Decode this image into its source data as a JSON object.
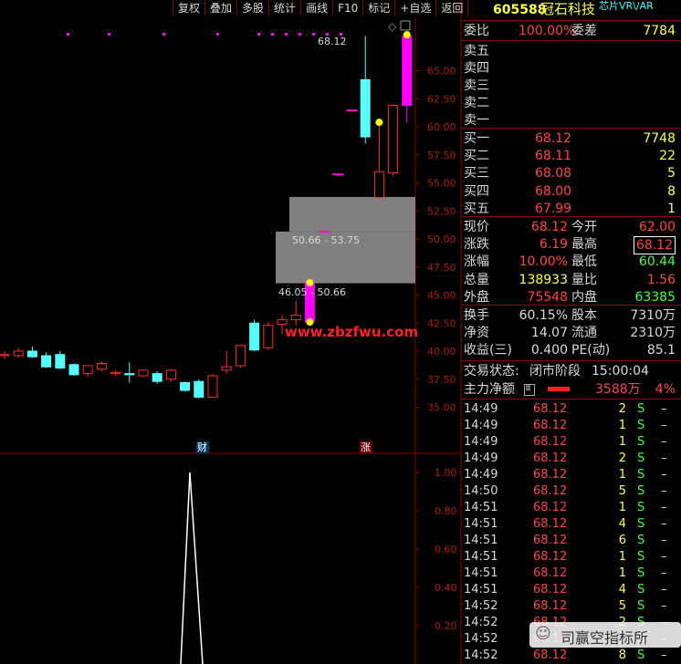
{
  "toolbar": [
    "复权",
    "叠加",
    "多股",
    "统计",
    "画线",
    "F10",
    "标记",
    "+自选",
    "返回"
  ],
  "watermark": "www.zbzfwu.com",
  "chart": {
    "max_label": "68.12",
    "zone_upper_label": "50.66 - 53.75",
    "zone_lower_label": "46.05 - 50.66",
    "price_axis": [
      "65.00",
      "62.50",
      "60.00",
      "57.50",
      "55.00",
      "52.50",
      "50.00",
      "47.50",
      "45.00",
      "42.50",
      "40.00",
      "37.50",
      "35.00"
    ],
    "markers": [
      "财",
      "涨"
    ],
    "indicator_axis": [
      "1.00",
      "0.80",
      "0.60",
      "0.40",
      "0.20"
    ],
    "candles": [
      {
        "o": 39.6,
        "h": 40.0,
        "l": 39.3,
        "c": 39.7
      },
      {
        "o": 39.6,
        "h": 40.3,
        "l": 39.4,
        "c": 40.0
      },
      {
        "o": 40.0,
        "h": 40.4,
        "l": 39.4,
        "c": 39.5
      },
      {
        "o": 39.6,
        "h": 39.9,
        "l": 38.5,
        "c": 38.6
      },
      {
        "o": 39.7,
        "h": 40.0,
        "l": 38.4,
        "c": 38.5
      },
      {
        "o": 38.8,
        "h": 38.9,
        "l": 37.8,
        "c": 37.9
      },
      {
        "o": 38.0,
        "h": 38.8,
        "l": 37.7,
        "c": 38.7
      },
      {
        "o": 38.4,
        "h": 39.1,
        "l": 38.2,
        "c": 38.9
      },
      {
        "o": 38.0,
        "h": 38.3,
        "l": 37.8,
        "c": 38.1
      },
      {
        "o": 38.0,
        "h": 39.0,
        "l": 37.2,
        "c": 37.9
      },
      {
        "o": 37.8,
        "h": 38.4,
        "l": 37.7,
        "c": 38.3
      },
      {
        "o": 38.0,
        "h": 38.2,
        "l": 37.1,
        "c": 37.3
      },
      {
        "o": 37.5,
        "h": 38.4,
        "l": 37.3,
        "c": 38.3
      },
      {
        "o": 37.2,
        "h": 37.3,
        "l": 36.4,
        "c": 36.5
      },
      {
        "o": 37.3,
        "h": 37.5,
        "l": 35.8,
        "c": 35.9
      },
      {
        "o": 35.9,
        "h": 38.0,
        "l": 35.9,
        "c": 37.8
      },
      {
        "o": 38.3,
        "h": 40.0,
        "l": 38.0,
        "c": 38.6
      },
      {
        "o": 38.7,
        "h": 40.6,
        "l": 38.5,
        "c": 40.5
      },
      {
        "o": 42.5,
        "h": 42.8,
        "l": 40.0,
        "c": 40.1
      },
      {
        "o": 40.3,
        "h": 42.6,
        "l": 40.1,
        "c": 42.3
      },
      {
        "o": 42.4,
        "h": 43.2,
        "l": 41.5,
        "c": 42.8
      },
      {
        "o": 42.8,
        "h": 44.5,
        "l": 42.3,
        "c": 43.2
      },
      {
        "o": 42.6,
        "h": 46.1,
        "l": 42.6,
        "c": 46.1
      },
      {
        "o": 50.7,
        "h": 50.7,
        "l": 50.7,
        "c": 50.7
      },
      {
        "o": 55.8,
        "h": 55.8,
        "l": 55.8,
        "c": 55.8
      },
      {
        "o": 61.5,
        "h": 61.5,
        "l": 61.5,
        "c": 61.5
      },
      {
        "o": 64.2,
        "h": 68.1,
        "l": 58.5,
        "c": 59.1
      },
      {
        "o": 53.7,
        "h": 60.4,
        "l": 53.6,
        "c": 56.0
      },
      {
        "o": 55.9,
        "h": 62.0,
        "l": 55.6,
        "c": 61.9
      },
      {
        "o": 61.9,
        "h": 68.2,
        "l": 60.4,
        "c": 68.1
      }
    ]
  },
  "quote": {
    "code": "605588",
    "name": "冠石科技",
    "tag": "芯片VR\\/AR",
    "weibi_label": "委比",
    "weibi_value": "100.00%",
    "weicha_label": "委差",
    "weicha_value": "7784",
    "sells": [
      "卖五",
      "卖四",
      "卖三",
      "卖二",
      "卖一"
    ],
    "buys": [
      {
        "label": "买一",
        "price": "68.12",
        "vol": "7748"
      },
      {
        "label": "买二",
        "price": "68.11",
        "vol": "22"
      },
      {
        "label": "买三",
        "price": "68.08",
        "vol": "5"
      },
      {
        "label": "买四",
        "price": "68.00",
        "vol": "8"
      },
      {
        "label": "买五",
        "price": "67.99",
        "vol": "1"
      }
    ],
    "stats": [
      {
        "l1": "现价",
        "v1": "68.12",
        "l2": "今开",
        "v2": "62.00"
      },
      {
        "l1": "涨跌",
        "v1": "6.19",
        "l2": "最高",
        "v2": "68.12"
      },
      {
        "l1": "涨幅",
        "v1": "10.00%",
        "l2": "最低",
        "v2": "60.44"
      },
      {
        "l1": "总量",
        "v1": "138933",
        "l2": "量比",
        "v2": "1.56"
      },
      {
        "l1": "外盘",
        "v1": "75548",
        "l2": "内盘",
        "v2": "63385"
      }
    ],
    "stats2": [
      {
        "l1": "换手",
        "v1": "60.15%",
        "l2": "股本",
        "v2": "7310万"
      },
      {
        "l1": "净资",
        "v1": "14.07",
        "l2": "流通",
        "v2": "2310万"
      },
      {
        "l1": "收益(三)",
        "v1": "0.400",
        "l2": "PE(动)",
        "v2": "85.1"
      }
    ],
    "status_label": "交易状态:",
    "status_value": "闭市阶段",
    "status_time": "15:00:04",
    "net_label": "主力净额",
    "net_value": "3588万",
    "net_pct": "4%",
    "net_fill": 0.5
  },
  "ticks": [
    {
      "t": "14:49",
      "p": "68.12",
      "v": "2",
      "s": "S"
    },
    {
      "t": "14:49",
      "p": "68.12",
      "v": "1",
      "s": "S"
    },
    {
      "t": "14:49",
      "p": "68.12",
      "v": "1",
      "s": "S"
    },
    {
      "t": "14:49",
      "p": "68.12",
      "v": "2",
      "s": "S"
    },
    {
      "t": "14:49",
      "p": "68.12",
      "v": "1",
      "s": "S"
    },
    {
      "t": "14:50",
      "p": "68.12",
      "v": "5",
      "s": "S"
    },
    {
      "t": "14:51",
      "p": "68.12",
      "v": "1",
      "s": "S"
    },
    {
      "t": "14:51",
      "p": "68.12",
      "v": "4",
      "s": "S"
    },
    {
      "t": "14:51",
      "p": "68.12",
      "v": "6",
      "s": "S"
    },
    {
      "t": "14:51",
      "p": "68.12",
      "v": "1",
      "s": "S"
    },
    {
      "t": "14:51",
      "p": "68.12",
      "v": "1",
      "s": "S"
    },
    {
      "t": "14:51",
      "p": "68.12",
      "v": "4",
      "s": "S"
    },
    {
      "t": "14:52",
      "p": "68.12",
      "v": "5",
      "s": "S"
    },
    {
      "t": "14:52",
      "p": "68.12",
      "v": "2",
      "s": "S"
    },
    {
      "t": "14:52",
      "p": "68.12",
      "v": "1",
      "s": "S"
    },
    {
      "t": "14:52",
      "p": "68.12",
      "v": "8",
      "s": "S"
    }
  ],
  "footer_brand": "司赢空指标所",
  "colors": {
    "up": "#ff2a2a",
    "down": "#55ffff",
    "limit": "#ff00ff",
    "zone": "#808080",
    "grid": "#8a0000"
  }
}
